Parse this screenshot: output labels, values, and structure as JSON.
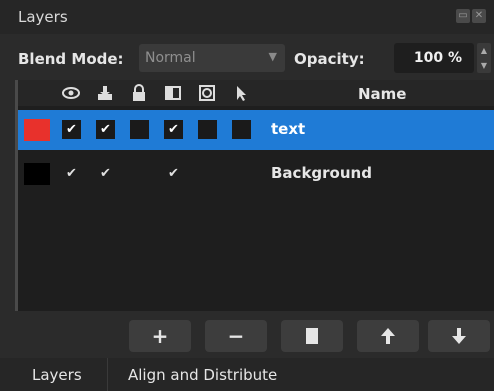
{
  "panel": {
    "title": "Layers"
  },
  "blend": {
    "label": "Blend Mode:",
    "value": "Normal"
  },
  "opacity": {
    "label": "Opacity:",
    "value": "100 %"
  },
  "table": {
    "name_header": "Name"
  },
  "layers": [
    {
      "name": "text",
      "swatch_color": "#e8312c",
      "selected": true,
      "checks": [
        "✔",
        "✔",
        "",
        "✔",
        "",
        ""
      ]
    },
    {
      "name": "Background",
      "swatch_color": "#000000",
      "selected": false,
      "checks": [
        "✔",
        "✔",
        "",
        "✔",
        "",
        ""
      ]
    }
  ],
  "buttons": {
    "add": "+",
    "remove": "−"
  },
  "tabs": {
    "layers": "Layers",
    "align": "Align and Distribute"
  },
  "colors": {
    "selection": "#1f7bd6",
    "panel": "#2b2b2b",
    "table": "#1e1e1e"
  }
}
